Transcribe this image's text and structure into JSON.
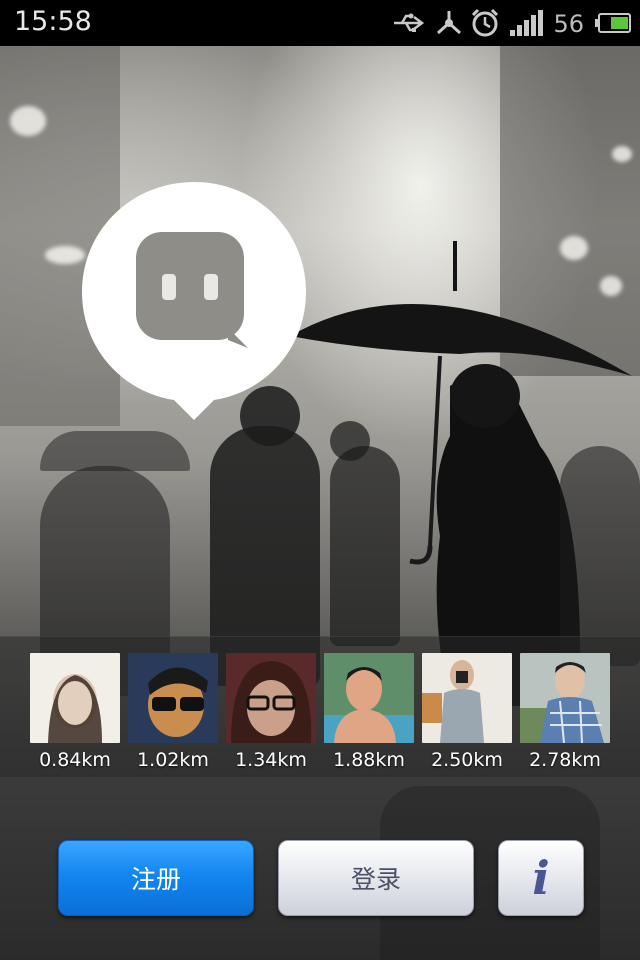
{
  "status_bar": {
    "time": "15:58",
    "battery_level": "56",
    "icons": [
      "usb-icon",
      "usb-debug-icon",
      "alarm-icon",
      "signal-icon",
      "battery-icon"
    ]
  },
  "people": [
    {
      "distance": "0.84km",
      "tone": "#d9c9b8"
    },
    {
      "distance": "1.02km",
      "tone": "#b77a3c"
    },
    {
      "distance": "1.34km",
      "tone": "#7a4a38"
    },
    {
      "distance": "1.88km",
      "tone": "#d79a79"
    },
    {
      "distance": "2.50km",
      "tone": "#e6e2d6"
    },
    {
      "distance": "2.78km",
      "tone": "#a7b0b8"
    }
  ],
  "buttons": {
    "register_label": "注册",
    "login_label": "登录",
    "info_label": "i"
  },
  "colors": {
    "register_blue": "#1386f0",
    "login_text": "#4a5066",
    "info_text": "#4a5596"
  }
}
